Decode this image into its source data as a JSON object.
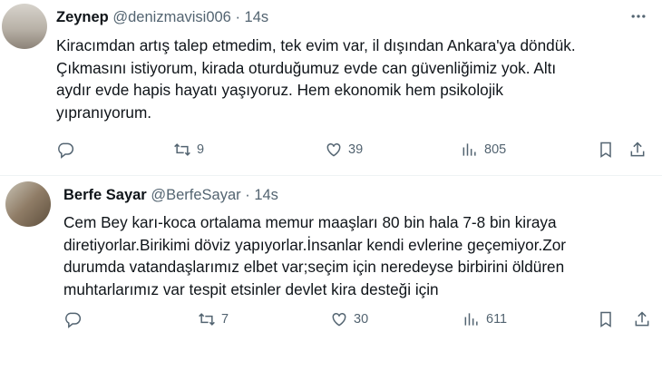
{
  "tweets": [
    {
      "name": "Zeynep",
      "handle": "@denizmavisi006",
      "sep": "·",
      "time": "14s",
      "lines": [
        "Kiracımdan artış talep etmedim, tek evim var, il dışından Ankara'ya döndük.",
        "Çıkmasını istiyorum, kirada oturduğumuz evde can güvenliğimiz yok. Altı",
        "aydır evde hapis hayatı yaşıyoruz. Hem ekonomik hem psikolojik",
        "yıpranıyorum."
      ],
      "reply_count": "",
      "retweet_count": "9",
      "like_count": "39",
      "view_count": "805"
    },
    {
      "name": "Berfe Sayar",
      "handle": "@BerfeSayar",
      "sep": "·",
      "time": "14s",
      "lines": [
        "Cem Bey karı-koca ortalama memur maaşları 80 bin hala 7-8 bin kiraya",
        "diretiyorlar.Birikimi döviz yapıyorlar.İnsanlar kendi evlerine geçemiyor.Zor",
        "durumda vatandaşlarımız elbet var;seçim için neredeyse birbirini öldüren",
        "muhtarlarımız var tespit etsinler devlet kira desteği için"
      ],
      "reply_count": "",
      "retweet_count": "7",
      "like_count": "30",
      "view_count": "611"
    }
  ],
  "icons": {
    "more": "more-dots-icon",
    "reply": "reply-icon",
    "retweet": "retweet-icon",
    "like": "heart-icon",
    "views": "views-icon",
    "bookmark": "bookmark-icon",
    "share": "share-icon"
  },
  "colors": {
    "text": "#0f1419",
    "muted": "#536471",
    "divider": "#eff3f4"
  }
}
